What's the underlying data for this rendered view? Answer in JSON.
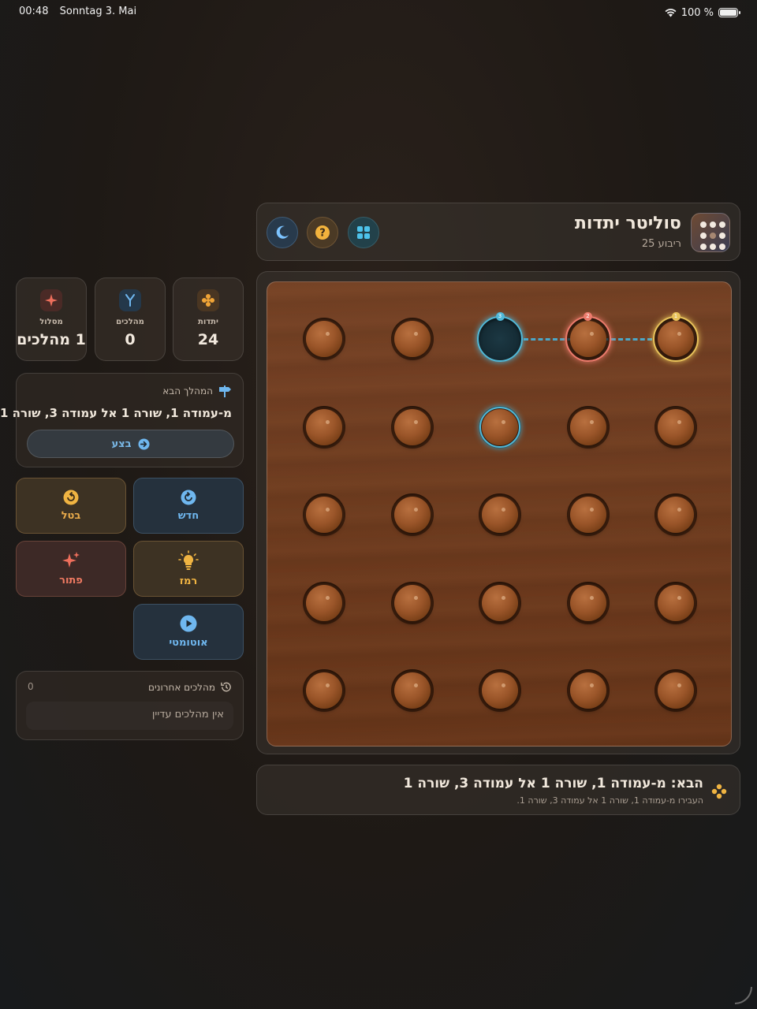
{
  "status_bar": {
    "time": "00:48",
    "date": "Sonntag 3. Mai",
    "battery": "100 %"
  },
  "header": {
    "title": "סוליטר יתדות",
    "subtitle": "ריבוע 25"
  },
  "stats": [
    {
      "label": "יתדות",
      "value": "24",
      "color": "#f0a437"
    },
    {
      "label": "מהלכים",
      "value": "0",
      "color": "#6fb7ef"
    },
    {
      "label": "מסלול",
      "value": "1 מהלכים",
      "color": "#ef6f5c"
    }
  ],
  "next_move": {
    "heading": "המהלך הבא",
    "text": "מ-עמודה 1, שורה 1 אל עמודה 3, שורה 1",
    "execute_label": "בצע"
  },
  "actions": {
    "undo": "בטל",
    "new": "חדש",
    "solve": "פתור",
    "hint": "רמז",
    "auto": "אוטומטי"
  },
  "recent": {
    "heading": "מהלכים אחרונים",
    "count": "0",
    "empty": "אין מהלכים עדיין"
  },
  "hint_bar": {
    "title": "הבא: מ-עמודה 1, שורה 1 אל עמודה 3, שורה 1",
    "subtitle": "העבירו מ-עמודה 1, שורה 1 אל עמודה 3, שורה 1."
  },
  "board": {
    "rows": 5,
    "cols": 5,
    "empty": [
      [
        0,
        2
      ]
    ],
    "highlights": [
      {
        "row": 0,
        "col": 4,
        "color": "#e8c25a",
        "badge": "1"
      },
      {
        "row": 0,
        "col": 3,
        "color": "#ec7b6c",
        "badge": "2"
      },
      {
        "row": 0,
        "col": 2,
        "color": "#4fb8d8",
        "badge": "3"
      },
      {
        "row": 1,
        "col": 2,
        "color": "#4fb8d8",
        "badge": ""
      }
    ]
  }
}
